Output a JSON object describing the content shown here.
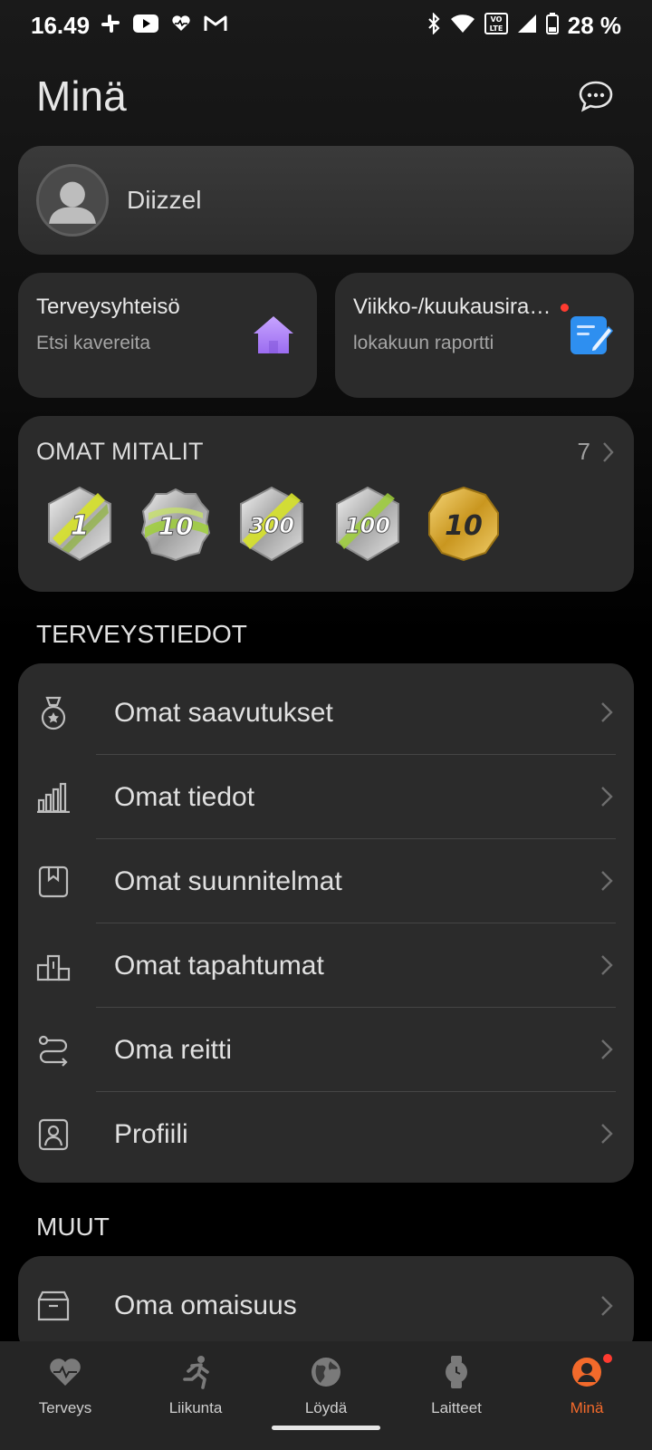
{
  "status_bar": {
    "time": "16.49",
    "battery": "28 %",
    "left_icons": [
      "slack-icon",
      "youtube-icon",
      "health-heart-icon",
      "gmail-icon"
    ],
    "right_icons": [
      "bluetooth-icon",
      "wifi-icon",
      "volte-icon",
      "signal-icon",
      "battery-icon"
    ]
  },
  "header": {
    "title": "Minä",
    "chat_icon": "chat-bubble-icon"
  },
  "profile": {
    "username": "Diizzel",
    "avatar_icon": "person-icon"
  },
  "community_card": {
    "title": "Terveysyhteisö",
    "subtitle": "Etsi kavereita",
    "icon": "house-icon",
    "icon_color": "#b48cff"
  },
  "report_card": {
    "title": "Viikko-/kuukausiraportti",
    "subtitle": "lokakuun raportti",
    "icon": "note-edit-icon",
    "icon_color": "#2e8ff0",
    "badge_color": "#ff3b30"
  },
  "medals": {
    "title": "OMAT MITALIT",
    "count": "7",
    "items": [
      {
        "label": "1",
        "style": "silver-yellow"
      },
      {
        "label": "10",
        "style": "silver-green"
      },
      {
        "label": "300",
        "style": "silver-yellow"
      },
      {
        "label": "100",
        "style": "silver-green"
      },
      {
        "label": "10",
        "style": "gold"
      }
    ]
  },
  "health_section": {
    "title": "TERVEYSTIEDOT",
    "items": [
      {
        "label": "Omat saavutukset",
        "icon": "medal-icon"
      },
      {
        "label": "Omat tiedot",
        "icon": "bar-chart-icon"
      },
      {
        "label": "Omat suunnitelmat",
        "icon": "bookmark-plan-icon"
      },
      {
        "label": "Omat tapahtumat",
        "icon": "podium-icon"
      },
      {
        "label": "Oma reitti",
        "icon": "route-icon"
      },
      {
        "label": "Profiili",
        "icon": "profile-card-icon"
      }
    ]
  },
  "other_section": {
    "title": "MUUT",
    "items": [
      {
        "label": "Oma omaisuus",
        "icon": "box-icon"
      }
    ]
  },
  "bottom_nav": {
    "items": [
      {
        "label": "Terveys",
        "icon": "heart-pulse-icon"
      },
      {
        "label": "Liikunta",
        "icon": "running-icon"
      },
      {
        "label": "Löydä",
        "icon": "globe-icon"
      },
      {
        "label": "Laitteet",
        "icon": "watch-icon"
      },
      {
        "label": "Minä",
        "icon": "person-circle-icon",
        "active": true
      }
    ],
    "active_color": "#f36a2b"
  }
}
